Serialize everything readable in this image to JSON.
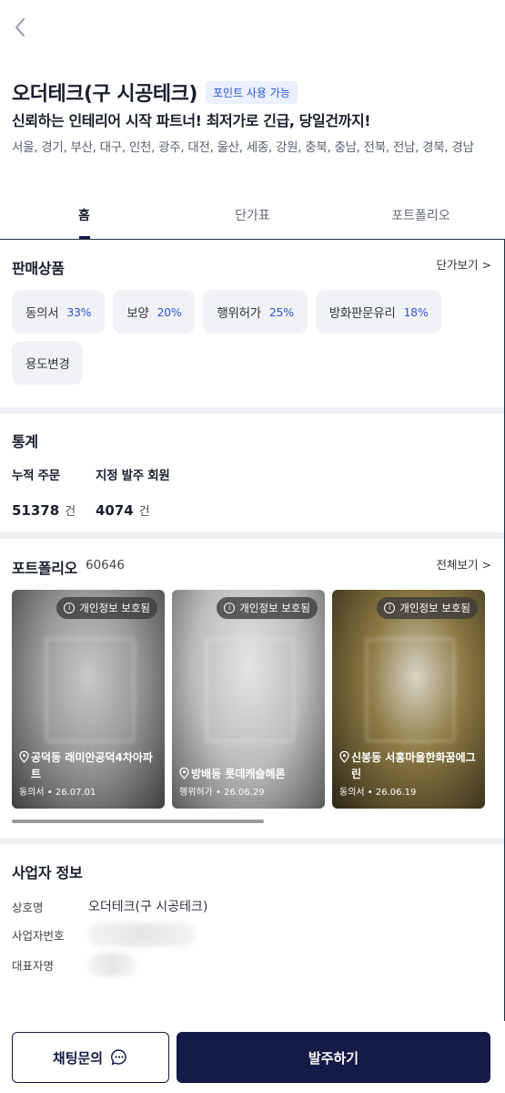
{
  "header": {
    "title": "오더테크(구 시공테크)",
    "badge": "포인트 사용 가능",
    "tagline": "신뢰하는 인테리어 시작 파트너! 최저가로 긴급, 당일건까지!",
    "regions": "서울, 경기, 부산, 대구, 인천, 광주, 대전, 울산, 세종, 강원, 충북, 충남, 전북, 전남, 경북, 경남"
  },
  "tabs": [
    {
      "label": "홈",
      "active": true
    },
    {
      "label": "단가표",
      "active": false
    },
    {
      "label": "포트폴리오",
      "active": false
    }
  ],
  "products": {
    "title": "판매상품",
    "more": "단가보기 >",
    "items": [
      {
        "name": "동의서",
        "pct": "33%"
      },
      {
        "name": "보양",
        "pct": "20%"
      },
      {
        "name": "행위허가",
        "pct": "25%"
      },
      {
        "name": "방화판문유리",
        "pct": "18%"
      },
      {
        "name": "용도변경",
        "pct": ""
      }
    ]
  },
  "stats": {
    "title": "통계",
    "orders_label": "누적 주문",
    "orders_value": "51378",
    "orders_unit": "건",
    "members_label": "지정 발주 회원",
    "members_value": "4074",
    "members_unit": "건"
  },
  "portfolio": {
    "title": "포트폴리오",
    "count": "60646",
    "more": "전체보기 >",
    "privacy_label": "개인정보 보호됨",
    "cards": [
      {
        "location": "공덕동 래미안공덕4차아파트",
        "meta": "동의서 • 26.07.01"
      },
      {
        "location": "방배동 롯데캐슬헤론",
        "meta": "행위허가 • 26.06.29"
      },
      {
        "location": "신봉동 서홍마을한화꿈에그린",
        "meta": "동의서 • 26.06.19"
      }
    ]
  },
  "business": {
    "title": "사업자 정보",
    "name_label": "상호명",
    "name_value": "오더테크(구 시공테크)",
    "reg_label": "사업자번호",
    "ceo_label": "대표자명"
  },
  "actions": {
    "chat_label": "채팅문의",
    "order_label": "발주하기"
  },
  "colors": {
    "accent": "#141b46",
    "link_blue": "#2c55d8"
  }
}
